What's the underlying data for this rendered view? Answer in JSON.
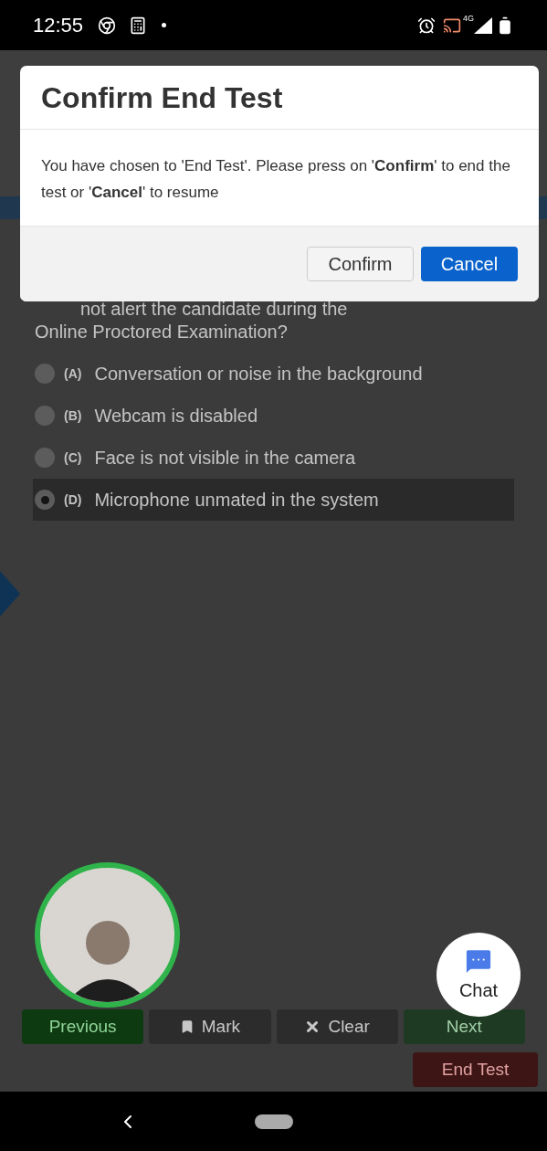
{
  "status_bar": {
    "time": "12:55",
    "network": "4G"
  },
  "dialog": {
    "title": "Confirm End Test",
    "message": "You have chosen to 'End Test'. Please press on '**Confirm**' to end the test or '**Cancel**' to resume",
    "buttons": [
      {
        "label": "Confirm",
        "kind": "secondary"
      },
      {
        "label": "Cancel",
        "kind": "primary"
      }
    ]
  },
  "question": {
    "lines": [
      "not alert the candidate during the",
      "Online Proctored Examination?"
    ]
  },
  "options": [
    {
      "letter": "(A)",
      "text": "Conversation or noise in the background",
      "selected": false
    },
    {
      "letter": "(B)",
      "text": "Webcam is disabled",
      "selected": false
    },
    {
      "letter": "(C)",
      "text": "Face is not visible in the camera",
      "selected": false
    },
    {
      "letter": "(D)",
      "text": "Microphone unmated in the system",
      "selected": true
    }
  ],
  "chat": {
    "label": "Chat"
  },
  "nav_buttons": [
    {
      "label": "Previous",
      "kind": "previous"
    },
    {
      "label": "Mark",
      "kind": "mark"
    },
    {
      "label": "Clear",
      "kind": "clear"
    },
    {
      "label": "Next",
      "kind": "next"
    }
  ],
  "end_test": {
    "label": "End Test"
  }
}
